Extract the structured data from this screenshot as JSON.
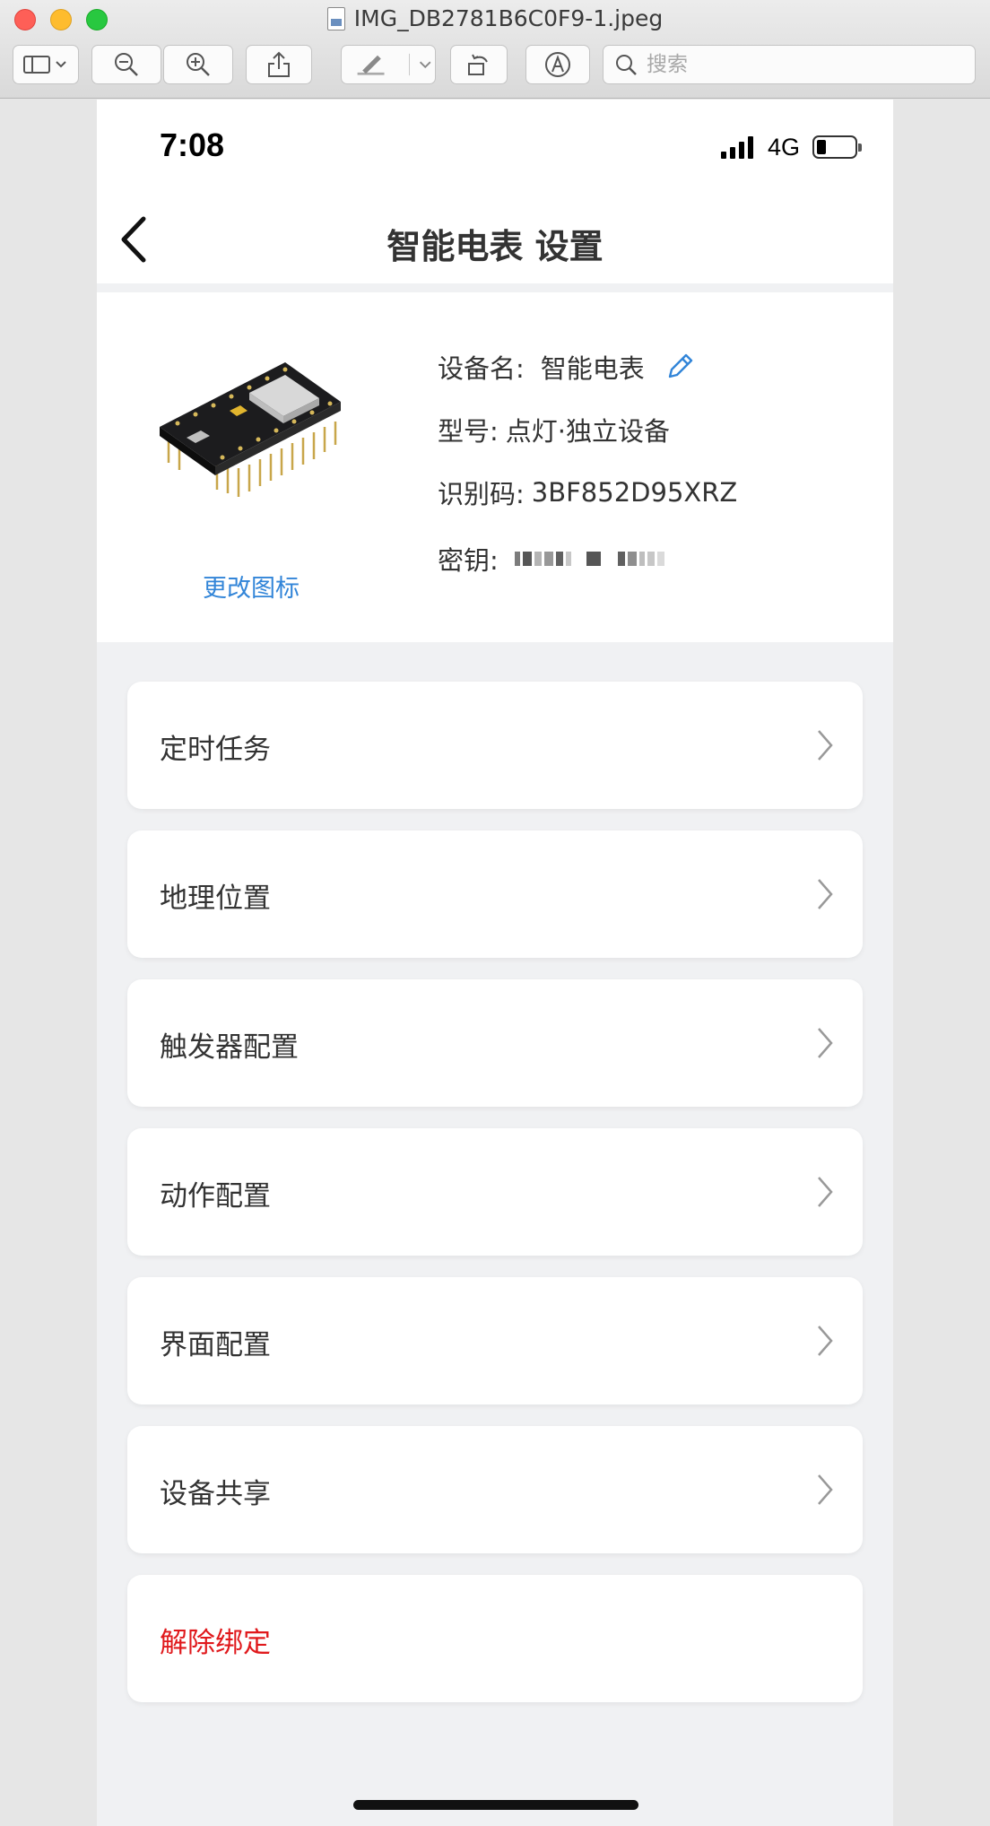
{
  "window": {
    "title": "IMG_DB2781B6C0F9-1.jpeg",
    "search_placeholder": "搜索"
  },
  "status_bar": {
    "time": "7:08",
    "network": "4G"
  },
  "nav": {
    "title": "智能电表 设置"
  },
  "device": {
    "name_label": "设备名:",
    "name_value": "智能电表",
    "model_label": "型号:",
    "model_value": "点灯·独立设备",
    "id_label": "识别码:",
    "id_value": "3BF852D95XRZ",
    "key_label": "密钥:",
    "change_icon_label": "更改图标"
  },
  "menu": [
    {
      "label": "定时任务"
    },
    {
      "label": "地理位置"
    },
    {
      "label": "触发器配置"
    },
    {
      "label": "动作配置"
    },
    {
      "label": "界面配置"
    },
    {
      "label": "设备共享"
    }
  ],
  "unbind": {
    "label": "解除绑定"
  },
  "colors": {
    "link": "#3285d8",
    "danger": "#e0191c",
    "page_bg": "#f0f1f3"
  }
}
